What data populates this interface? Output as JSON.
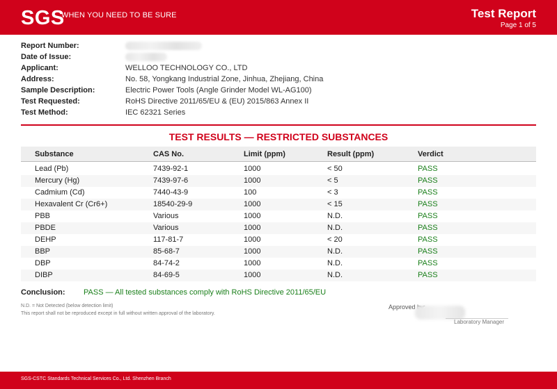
{
  "header": {
    "logo": "SGS",
    "tagline": "WHEN YOU NEED TO BE SURE",
    "title": "Test Report",
    "page": "Page 1 of 5"
  },
  "info": {
    "rows": [
      {
        "label": "Report Number:",
        "value": ""
      },
      {
        "label": "Date of Issue:",
        "value": ""
      },
      {
        "label": "Applicant:",
        "value": "WELLOO TECHNOLOGY CO., LTD"
      },
      {
        "label": "Address:",
        "value": "No. 58, Yongkang Industrial Zone, Jinhua, Zhejiang, China"
      },
      {
        "label": "Sample Description:",
        "value": "Electric Power Tools (Angle Grinder Model WL-AG100)"
      },
      {
        "label": "Test Requested:",
        "value": "RoHS Directive 2011/65/EU & (EU) 2015/863 Annex II"
      },
      {
        "label": "Test Method:",
        "value": "IEC 62321 Series"
      }
    ]
  },
  "results": {
    "title": "TEST RESULTS — RESTRICTED SUBSTANCES",
    "columns": [
      "Substance",
      "CAS No.",
      "Limit (ppm)",
      "Result (ppm)",
      "Verdict"
    ],
    "rows": [
      [
        "Lead (Pb)",
        "7439-92-1",
        "1000",
        "< 50",
        "PASS"
      ],
      [
        "Mercury (Hg)",
        "7439-97-6",
        "1000",
        "< 5",
        "PASS"
      ],
      [
        "Cadmium (Cd)",
        "7440-43-9",
        "100",
        "< 3",
        "PASS"
      ],
      [
        "Hexavalent Cr (Cr6+)",
        "18540-29-9",
        "1000",
        "< 15",
        "PASS"
      ],
      [
        "PBB",
        "Various",
        "1000",
        "N.D.",
        "PASS"
      ],
      [
        "PBDE",
        "Various",
        "1000",
        "N.D.",
        "PASS"
      ],
      [
        "DEHP",
        "117-81-7",
        "1000",
        "< 20",
        "PASS"
      ],
      [
        "BBP",
        "85-68-7",
        "1000",
        "N.D.",
        "PASS"
      ],
      [
        "DBP",
        "84-74-2",
        "1000",
        "N.D.",
        "PASS"
      ],
      [
        "DIBP",
        "84-69-5",
        "1000",
        "N.D.",
        "PASS"
      ]
    ]
  },
  "conclusion": {
    "label": "Conclusion:",
    "text": "PASS — All tested substances comply with RoHS Directive 2011/65/EU"
  },
  "notes": [
    "N.D. = Not Detected (below detection limit)",
    "This report shall not be reproduced except in full without written approval of the laboratory."
  ],
  "approval": {
    "approved_label": "Approved by:",
    "role": "Laboratory Manager"
  },
  "footer": {
    "text": "SGS-CSTC Standards Technical Services Co., Ltd. Shenzhen Branch"
  },
  "colors": {
    "brand_red": "#d0021b",
    "pass_green": "#1a7f1a"
  }
}
